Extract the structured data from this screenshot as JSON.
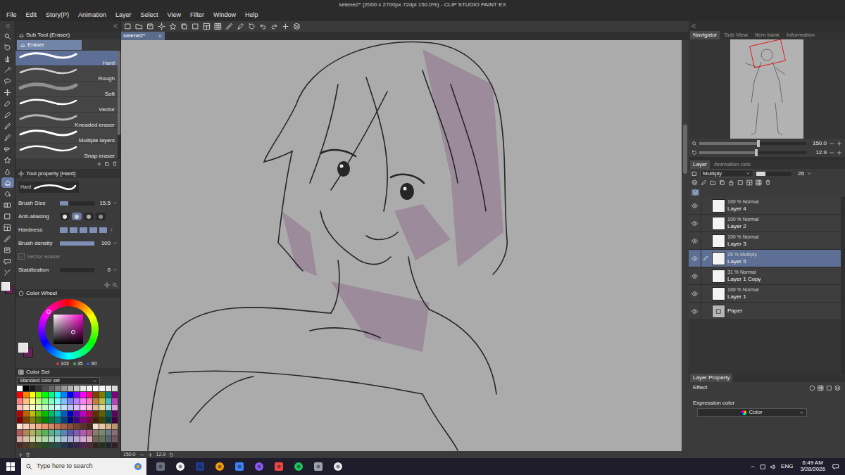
{
  "window": {
    "title": "selene2* (2000 x 2700px 72dpi 150.0%) - CLIP STUDIO PAINT EX"
  },
  "menu": [
    "File",
    "Edit",
    "Story(P)",
    "Animation",
    "Layer",
    "Select",
    "View",
    "Filter",
    "Window",
    "Help"
  ],
  "tools": [
    {
      "selected": false
    },
    {
      "selected": false
    },
    {
      "selected": false
    },
    {
      "selected": false
    },
    {
      "selected": false
    },
    {
      "selected": false
    },
    {
      "selected": false
    },
    {
      "selected": false
    },
    {
      "selected": false
    },
    {
      "selected": false
    },
    {
      "selected": false
    },
    {
      "selected": false
    },
    {
      "selected": false
    },
    {
      "selected": true
    },
    {
      "selected": false
    },
    {
      "selected": false
    },
    {
      "selected": false
    },
    {
      "selected": false
    },
    {
      "selected": false
    },
    {
      "selected": false
    },
    {
      "selected": false
    },
    {
      "selected": false
    }
  ],
  "current_colors": [
    {
      "color": "#e6e6e6",
      "selected": true
    },
    {
      "color": "#67235a",
      "selected": false
    }
  ],
  "sub_tool": {
    "title": "Sub Tool (Eraser)",
    "tab": "Eraser",
    "items": [
      {
        "label": "Hard",
        "selected": true
      },
      {
        "label": "Rough",
        "selected": false
      },
      {
        "label": "Soft",
        "selected": false
      },
      {
        "label": "Vector",
        "selected": false
      },
      {
        "label": "Kneaded eraser",
        "selected": false
      },
      {
        "label": "Multiple layers",
        "selected": false
      },
      {
        "label": "Snap eraser",
        "selected": false
      }
    ]
  },
  "tool_property": {
    "title": "Tool property [Hard]",
    "preview": "Hard",
    "rows": [
      {
        "kind": "slider",
        "label": "Brush Size",
        "value": "15.5",
        "level": 0.25
      },
      {
        "kind": "choice",
        "label": "Anti-aliasing",
        "choices": [
          {
            "selected": false
          },
          {
            "selected": true
          },
          {
            "selected": false
          },
          {
            "selected": false
          }
        ]
      },
      {
        "kind": "steps",
        "label": "Hardness",
        "steps": [
          {
            "on": true
          },
          {
            "on": true
          },
          {
            "on": true
          },
          {
            "on": true
          },
          {
            "on": true
          }
        ]
      },
      {
        "kind": "slider",
        "label": "Brush density",
        "value": "100",
        "level": 1
      },
      {
        "kind": "check",
        "label": "Vector eraser",
        "checked": true,
        "disabled": true
      },
      {
        "kind": "slider",
        "label": "Stabilization",
        "value": "0",
        "level": 0
      }
    ]
  },
  "color_wheel": {
    "title": "Color Wheel",
    "color": "#67235a",
    "values": [
      {
        "label": "103",
        "color": "#e03a3a"
      },
      {
        "label": "35",
        "color": "#3ac03a"
      },
      {
        "label": "90",
        "color": "#3a5ae0"
      }
    ]
  },
  "color_set": {
    "title": "Color Set",
    "set": "Standard color set",
    "swatches": [
      [
        "#ffffff",
        "#000000",
        "#1a1a1a",
        "#333333",
        "#4d4d4d",
        "#666666",
        "#808080",
        "#999999",
        "#b3b3b3",
        "#cccccc",
        "#e6e6e6",
        "#f2f2f2",
        "#ffffff",
        "#f5f5f5",
        "#ebebeb",
        "#d9d9d9"
      ],
      [
        "#ff0000",
        "#ff8000",
        "#ffff00",
        "#80ff00",
        "#00ff00",
        "#00ff80",
        "#00ffff",
        "#0080ff",
        "#0000ff",
        "#8000ff",
        "#ff00ff",
        "#ff0080",
        "#804000",
        "#808000",
        "#008080",
        "#800080"
      ],
      [
        "#ff8080",
        "#ffbf80",
        "#ffff80",
        "#bfff80",
        "#80ff80",
        "#80ffbf",
        "#80ffff",
        "#80bfff",
        "#8080ff",
        "#bf80ff",
        "#ff80ff",
        "#ff80bf",
        "#c08040",
        "#c0c040",
        "#40c0c0",
        "#c040c0"
      ],
      [
        "#ffc0c0",
        "#ffe0c0",
        "#ffffc0",
        "#e0ffc0",
        "#c0ffc0",
        "#c0ffe0",
        "#c0ffff",
        "#c0e0ff",
        "#c0c0ff",
        "#e0c0ff",
        "#ffc0ff",
        "#ffc0e0",
        "#e0c0a0",
        "#e0e0a0",
        "#a0e0e0",
        "#e0a0e0"
      ],
      [
        "#c00000",
        "#c06000",
        "#c0c000",
        "#60c000",
        "#00c000",
        "#00c060",
        "#00c0c0",
        "#0060c0",
        "#0000c0",
        "#6000c0",
        "#c000c0",
        "#c00060",
        "#603000",
        "#606000",
        "#006060",
        "#600060"
      ],
      [
        "#800000",
        "#804000",
        "#808000",
        "#408000",
        "#008000",
        "#008040",
        "#008080",
        "#004080",
        "#000080",
        "#400080",
        "#800080",
        "#800040",
        "#402000",
        "#404000",
        "#004040",
        "#400040"
      ],
      [
        "#fde3d2",
        "#f9d1b7",
        "#f5bf9c",
        "#efac85",
        "#e49872",
        "#d68562",
        "#c27253",
        "#a85f45",
        "#8e4e39",
        "#753f2f",
        "#5d3126",
        "#46251d",
        "#f2e0c9",
        "#e6c9a8",
        "#d4b08a",
        "#bf976f"
      ],
      [
        "#b35959",
        "#b38659",
        "#b3b359",
        "#86b359",
        "#59b359",
        "#59b386",
        "#59b3b3",
        "#5986b3",
        "#5959b3",
        "#8659b3",
        "#b359b3",
        "#b35986",
        "#8c7a6b",
        "#7a8c6b",
        "#6b7a8c",
        "#8c6b7a"
      ],
      [
        "#d9a6a6",
        "#d9bfa6",
        "#d9d9a6",
        "#bfd9a6",
        "#a6d9a6",
        "#a6d9bf",
        "#a6d9d9",
        "#a6bfd9",
        "#a6a6d9",
        "#bfa6d9",
        "#d9a6d9",
        "#d9a6bf",
        "#736357",
        "#637357",
        "#576373",
        "#735763"
      ],
      [
        "#4d2626",
        "#4d3926",
        "#4d4d26",
        "#394d26",
        "#264d26",
        "#264d39",
        "#264d4d",
        "#26394d",
        "#26264d",
        "#39264d",
        "#4d264d",
        "#4d2639",
        "#2e2620",
        "#262e20",
        "#20262e",
        "#2e2026"
      ]
    ]
  },
  "canvas": {
    "tab": "selene2*",
    "zoom": "150.0",
    "angle": "12.9"
  },
  "navigator": {
    "tabs": [
      {
        "label": "Navigator",
        "selected": true
      },
      {
        "label": "Sub View",
        "selected": false
      },
      {
        "label": "Item bank",
        "selected": false
      },
      {
        "label": "Information",
        "selected": false
      }
    ],
    "zoom": {
      "value": "150.0",
      "level": 0.55
    },
    "angle": {
      "value": "12.9",
      "level": 0.53
    }
  },
  "layer_panel": {
    "tabs": [
      {
        "label": "Layer",
        "selected": true
      },
      {
        "label": "Animation cels",
        "selected": false
      }
    ],
    "blend_mode": "Multiply",
    "opacity": "26",
    "opacity_level": 0.26,
    "layers": [
      {
        "mode": "100 % Normal",
        "name": "Layer 4",
        "visible": true,
        "selected": false,
        "kind": "raster"
      },
      {
        "mode": "100 % Normal",
        "name": "Layer 2",
        "visible": true,
        "selected": false,
        "kind": "raster"
      },
      {
        "mode": "100 % Normal",
        "name": "Layer 3",
        "visible": true,
        "selected": false,
        "kind": "raster"
      },
      {
        "mode": "26 % Multiply",
        "name": "Layer 5",
        "visible": true,
        "selected": true,
        "kind": "raster"
      },
      {
        "mode": "31 % Normal",
        "name": "Layer 1 Copy",
        "visible": true,
        "selected": false,
        "kind": "raster"
      },
      {
        "mode": "100 % Normal",
        "name": "Layer 1",
        "visible": true,
        "selected": false,
        "kind": "raster"
      },
      {
        "name": "Paper",
        "visible": true,
        "selected": false,
        "kind": "paper"
      }
    ]
  },
  "layer_property": {
    "tabs": [
      {
        "label": "Layer Property",
        "selected": true
      }
    ],
    "effect_label": "Effect",
    "expression_label": "Expression color",
    "expression_value": "Color"
  },
  "taskbar": {
    "search": "Type here to search",
    "language": "ENG",
    "time": "6:49 AM",
    "date": "3/28/2026"
  }
}
